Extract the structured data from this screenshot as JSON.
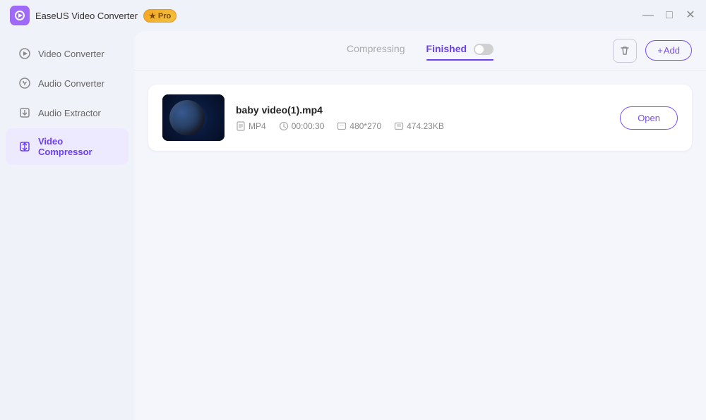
{
  "app": {
    "title": "EaseUS Video Converter",
    "pro_label": "★ Pro"
  },
  "titlebar": {
    "minimize_label": "—",
    "maximize_label": "□",
    "close_label": "✕"
  },
  "sidebar": {
    "items": [
      {
        "id": "video-converter",
        "label": "Video Converter",
        "active": false
      },
      {
        "id": "audio-converter",
        "label": "Audio Converter",
        "active": false
      },
      {
        "id": "audio-extractor",
        "label": "Audio Extractor",
        "active": false
      },
      {
        "id": "video-compressor",
        "label": "Video Compressor",
        "active": true
      }
    ]
  },
  "tabs": {
    "compressing_label": "Compressing",
    "finished_label": "Finished",
    "active": "finished"
  },
  "toolbar": {
    "add_label": "+ Add"
  },
  "file": {
    "name": "baby video(1).mp4",
    "format": "MP4",
    "duration": "00:00:30",
    "resolution": "480*270",
    "size": "474.23KB",
    "open_label": "Open"
  }
}
